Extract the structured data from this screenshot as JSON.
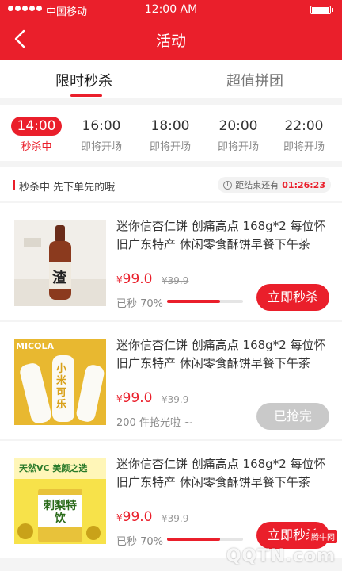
{
  "status": {
    "carrier": "中国移动",
    "time": "12:00 AM"
  },
  "nav": {
    "title": "活动"
  },
  "tabs": [
    {
      "label": "限时秒杀"
    },
    {
      "label": "超值拼团"
    }
  ],
  "slots": [
    {
      "time": "14:00",
      "state": "秒杀中"
    },
    {
      "time": "16:00",
      "state": "即将开场"
    },
    {
      "time": "18:00",
      "state": "即将开场"
    },
    {
      "time": "20:00",
      "state": "即将开场"
    },
    {
      "time": "22:00",
      "state": "即将开场"
    }
  ],
  "section": {
    "label": "秒杀中 先下单先的哦",
    "countdown_label": "距结束还有",
    "countdown": "01:26:23"
  },
  "products": [
    {
      "title": "迷你信杏仁饼 创痛高点 168g*2 每位怀旧广东特产 休闲零食酥饼早餐下午茶",
      "currency": "¥",
      "price": "99.0",
      "old_price": "¥39.9",
      "sold": "已秒 70%",
      "progress": 0.7,
      "button": "立即秒杀"
    },
    {
      "title": "迷你信杏仁饼 创痛高点 168g*2 每位怀旧广东特产 休闲零食酥饼早餐下午茶",
      "currency": "¥",
      "price": "99.0",
      "old_price": "¥39.9",
      "sold": "200 件抢光啦 ~",
      "button": "已抢完"
    },
    {
      "title": "迷你信杏仁饼 创痛高点 168g*2 每位怀旧广东特产 休闲零食酥饼早餐下午茶",
      "currency": "¥",
      "price": "99.0",
      "old_price": "¥39.9",
      "sold": "已秒 70%",
      "progress": 0.7,
      "button": "立即秒杀"
    }
  ],
  "images": {
    "p1_text": "渣",
    "p2_brand": "MICOLA",
    "p2_text": "小米可乐",
    "p3_headline": "天然VC 美颜之选",
    "p3_text": "刺梨特饮"
  },
  "watermark": {
    "badge": "腾牛网",
    "word": "QQTN.com"
  },
  "colors": {
    "accent": "#ea1f2b"
  }
}
